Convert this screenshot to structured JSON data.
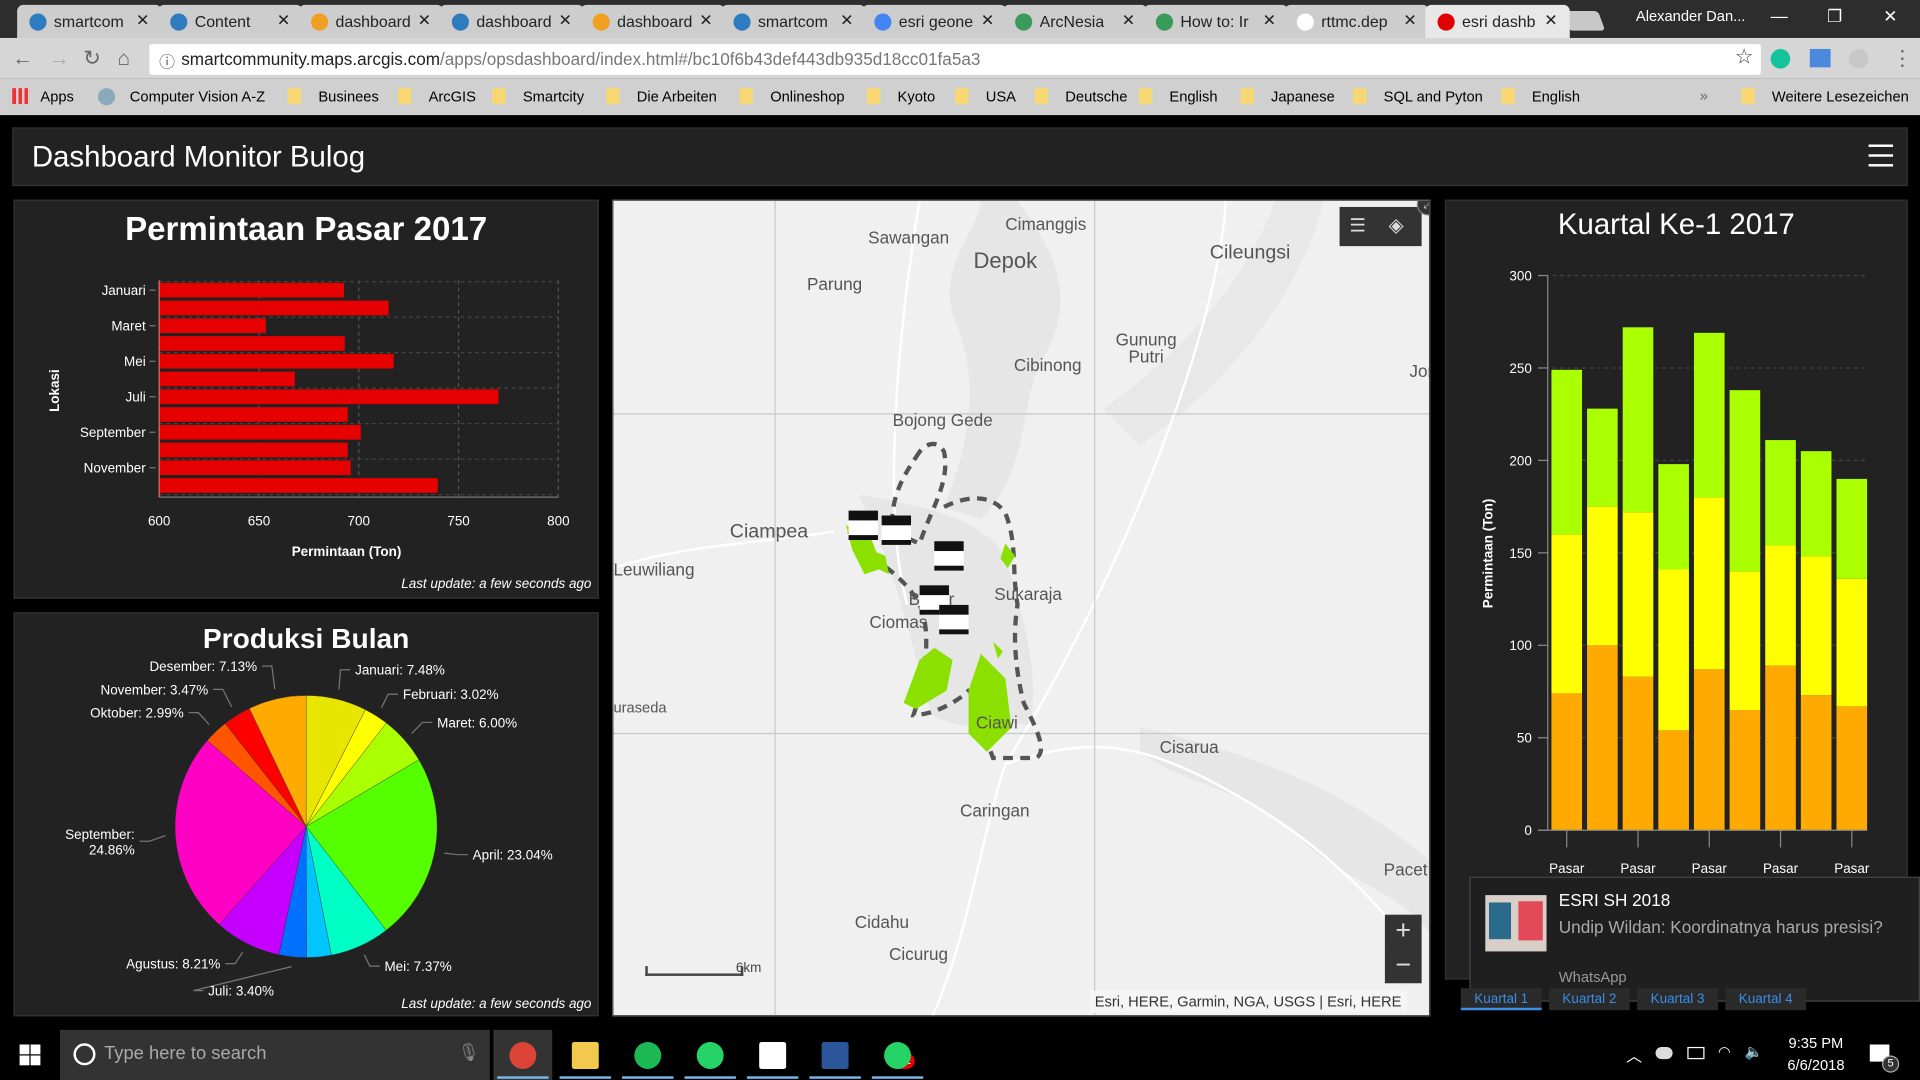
{
  "browser": {
    "tabs": [
      {
        "label": "smartcom",
        "icon": "arcgis-globe-icon",
        "color": "#2f7bbf"
      },
      {
        "label": "Content",
        "icon": "arcgis-globe-icon",
        "color": "#2f7bbf"
      },
      {
        "label": "dashboard",
        "icon": "dashboard-icon",
        "color": "#f0a020"
      },
      {
        "label": "dashboard",
        "icon": "arcgis-globe-icon",
        "color": "#2f7bbf"
      },
      {
        "label": "dashboard",
        "icon": "dashboard-icon",
        "color": "#f0a020"
      },
      {
        "label": "smartcom",
        "icon": "arcgis-globe-icon",
        "color": "#2f7bbf"
      },
      {
        "label": "esri geone",
        "icon": "google-icon",
        "color": "#4285f4"
      },
      {
        "label": "ArcNesia",
        "icon": "arcgis-globe-icon",
        "color": "#3a9a5a"
      },
      {
        "label": "How to: Ir",
        "icon": "arcgis-globe-icon",
        "color": "#3a9a5a"
      },
      {
        "label": "rttmc.dep",
        "icon": "document-icon",
        "color": "#ffffff"
      },
      {
        "label": "esri dashb",
        "icon": "youtube-icon",
        "color": "#e00000"
      }
    ],
    "profile": "Alexander Dan...",
    "url_host": "smartcommunity.maps.arcgis.com",
    "url_path": "/apps/opsdashboard/index.html#/bc10f6b43def443db935d18cc01fa5a3",
    "bookmarks": [
      "Apps",
      "Computer Vision A-Z",
      "Businees",
      "ArcGIS",
      "Smartcity",
      "Die Arbeiten",
      "Onlineshop",
      "Kyoto",
      "USA",
      "Deutsche",
      "English",
      "Japanese",
      "SQL and Pyton",
      "English"
    ],
    "more_bookmarks": "»",
    "other_bookmarks": "Weitere Lesezeichen"
  },
  "dashboard": {
    "title": "Dashboard Monitor Bulog",
    "last_update": "Last update: a few seconds ago"
  },
  "chart_data": [
    {
      "type": "bar",
      "orientation": "horizontal",
      "title": "Permintaan Pasar 2017",
      "xlabel": "Permintaan (Ton)",
      "ylabel": "Lokasi",
      "categories": [
        "Januari",
        "",
        "Maret",
        "",
        "Mei",
        "",
        "Juli",
        "",
        "September",
        "",
        "November",
        ""
      ],
      "values": [
        692.6,
        715,
        653.5,
        693,
        717.5,
        668,
        770,
        694.5,
        701,
        694.5,
        696,
        739.6
      ],
      "xlim": [
        600,
        800
      ],
      "xticks": [
        "600",
        "650",
        "700",
        "750",
        "800"
      ],
      "color": "#e60000",
      "grid": true
    },
    {
      "type": "pie",
      "title": "Produksi Bulan",
      "slices": [
        {
          "label": "Januari: 7.48%",
          "value": 7.48,
          "color": "#e6e600"
        },
        {
          "label": "Februari: 3.02%",
          "value": 3.02,
          "color": "#ffff00"
        },
        {
          "label": "Maret: 6.00%",
          "value": 6.0,
          "color": "#aaff00"
        },
        {
          "label": "April: 23.04%",
          "value": 23.04,
          "color": "#55ff00"
        },
        {
          "label": "Mei: 7.37%",
          "value": 7.37,
          "color": "#00ffc5"
        },
        {
          "label": "",
          "value": 3.03,
          "color": "#00c5ff"
        },
        {
          "label": "Juli: 3.40%",
          "value": 3.4,
          "color": "#0070ff"
        },
        {
          "label": "Agustus: 8.21%",
          "value": 8.21,
          "color": "#c500ff"
        },
        {
          "label": "September: 24.86%",
          "value": 24.86,
          "color": "#ff00c5"
        },
        {
          "label": "Oktober: 2.99%",
          "value": 2.99,
          "color": "#ff5500"
        },
        {
          "label": "November: 3.47%",
          "value": 3.47,
          "color": "#ff0000"
        },
        {
          "label": "Desember: 7.13%",
          "value": 7.13,
          "color": "#ffaa00"
        }
      ]
    },
    {
      "type": "bar",
      "stacked": true,
      "title": "Kuartal Ke-1 2017",
      "ylabel": "Permintaan (Ton)",
      "ylim": [
        0,
        300
      ],
      "yticks": [
        "0",
        "50",
        "100",
        "150",
        "200",
        "250",
        "300"
      ],
      "categories": [
        "Pasar",
        "",
        "Pasar",
        "",
        "Pasar",
        "",
        "Pasar",
        "",
        "Pasar"
      ],
      "series": [
        {
          "color": "#ffaa00",
          "values": [
            74,
            100,
            83,
            54,
            87,
            65,
            89,
            73,
            67
          ]
        },
        {
          "color": "#ffff00",
          "values": [
            86,
            75,
            89,
            87,
            93,
            75,
            65,
            75,
            69
          ]
        },
        {
          "color": "#aaff00",
          "values": [
            89,
            53,
            100,
            57,
            89,
            98,
            57,
            57,
            54
          ]
        }
      ],
      "grid": true
    }
  ],
  "quarter_tabs": [
    "Kuartal 1",
    "Kuartal 2",
    "Kuartal 3",
    "Kuartal 4"
  ],
  "map": {
    "places": [
      {
        "name": "Sawangan"
      },
      {
        "name": "Cimanggis"
      },
      {
        "name": "Depok"
      },
      {
        "name": "Cileungsi"
      },
      {
        "name": "Parung"
      },
      {
        "name": "Gunung Putri"
      },
      {
        "name": "Cibinong"
      },
      {
        "name": "Jor"
      },
      {
        "name": "Bojong Gede"
      },
      {
        "name": "Ciampea"
      },
      {
        "name": "Leuwiliang"
      },
      {
        "name": "Sukaraja"
      },
      {
        "name": "Bogor"
      },
      {
        "name": "Ciomas"
      },
      {
        "name": "uraseda"
      },
      {
        "name": "Ciawi"
      },
      {
        "name": "Cisarua"
      },
      {
        "name": "Caringan"
      },
      {
        "name": "Pacet"
      },
      {
        "name": "Cidahu"
      },
      {
        "name": "Cicurug"
      }
    ],
    "scale": "6km",
    "attribution": "Esri, HERE, Garmin, NGA, USGS | Esri, HERE",
    "zoom_in": "+",
    "zoom_out": "−",
    "boundary_color": "#555555",
    "area_color": "#8be000"
  },
  "notification": {
    "title": "ESRI SH 2018",
    "message": "Undip Wildan: Koordinatnya harus presisi?",
    "app": "WhatsApp"
  },
  "taskbar": {
    "search_placeholder": "Type here to search",
    "apps": [
      {
        "name": "chrome",
        "color": "#db4437"
      },
      {
        "name": "file-explorer",
        "color": "#f2c94c"
      },
      {
        "name": "spotify",
        "color": "#1db954"
      },
      {
        "name": "whatsapp",
        "color": "#25d366"
      },
      {
        "name": "store",
        "color": "#ffffff"
      },
      {
        "name": "word",
        "color": "#2b579a"
      },
      {
        "name": "whatsapp-web",
        "color": "#25d366"
      }
    ],
    "whatsapp_badge": "22",
    "time": "9:35 PM",
    "date": "6/6/2018",
    "notifications_count": "5"
  }
}
